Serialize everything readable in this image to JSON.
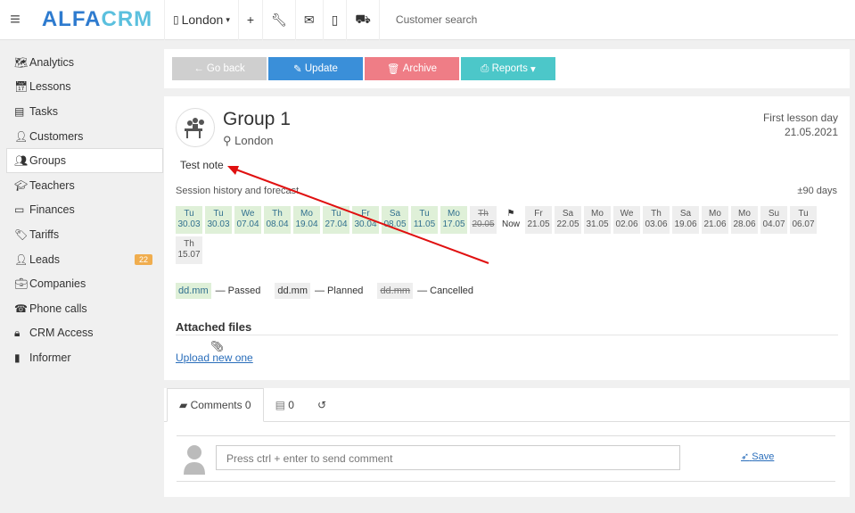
{
  "top": {
    "logo_a": "ALFA",
    "logo_b": "CRM",
    "branch": "London",
    "search": "Customer search"
  },
  "sidebar": {
    "items": [
      {
        "label": "Analytics",
        "icon": "map-icon"
      },
      {
        "label": "Lessons",
        "icon": "calendar-icon"
      },
      {
        "label": "Tasks",
        "icon": "tasks-icon"
      },
      {
        "label": "Customers",
        "icon": "user-icon"
      },
      {
        "label": "Groups",
        "icon": "group-icon"
      },
      {
        "label": "Teachers",
        "icon": "graduation-cap-icon"
      },
      {
        "label": "Finances",
        "icon": "money-icon"
      },
      {
        "label": "Tariffs",
        "icon": "tag-icon"
      },
      {
        "label": "Leads",
        "icon": "add-user-icon"
      },
      {
        "label": "Companies",
        "icon": "briefcase-icon"
      },
      {
        "label": "Phone calls",
        "icon": "phone-icon"
      },
      {
        "label": "CRM Access",
        "icon": "lock-icon"
      },
      {
        "label": "Informer",
        "icon": "book-icon"
      }
    ],
    "leads_badge": "22"
  },
  "actions": {
    "back": "← Go back",
    "update": "Update",
    "archive": "Archive",
    "reports": "Reports"
  },
  "group": {
    "title": "Group 1",
    "location": "London",
    "first_lesson_label": "First lesson day",
    "first_lesson_date": "21.05.2021",
    "note": "Test note",
    "history_label": "Session history and forecast",
    "range": "±90 days"
  },
  "days": [
    {
      "wd": "Tu",
      "dt": "30.03",
      "s": "p"
    },
    {
      "wd": "Tu",
      "dt": "30.03",
      "s": "p"
    },
    {
      "wd": "We",
      "dt": "07.04",
      "s": "p"
    },
    {
      "wd": "Th",
      "dt": "08.04",
      "s": "p"
    },
    {
      "wd": "Mo",
      "dt": "19.04",
      "s": "p"
    },
    {
      "wd": "Tu",
      "dt": "27.04",
      "s": "p"
    },
    {
      "wd": "Fr",
      "dt": "30.04",
      "s": "p"
    },
    {
      "wd": "Sa",
      "dt": "08.05",
      "s": "p"
    },
    {
      "wd": "Tu",
      "dt": "11.05",
      "s": "p"
    },
    {
      "wd": "Mo",
      "dt": "17.05",
      "s": "p"
    },
    {
      "wd": "Th",
      "dt": "20.05",
      "s": "c"
    },
    {
      "wd": "⚑",
      "dt": "Now",
      "s": "n"
    },
    {
      "wd": "Fr",
      "dt": "21.05",
      "s": "f"
    },
    {
      "wd": "Sa",
      "dt": "22.05",
      "s": "f"
    },
    {
      "wd": "Mo",
      "dt": "31.05",
      "s": "f"
    },
    {
      "wd": "We",
      "dt": "02.06",
      "s": "f"
    },
    {
      "wd": "Th",
      "dt": "03.06",
      "s": "f"
    },
    {
      "wd": "Sa",
      "dt": "19.06",
      "s": "f"
    },
    {
      "wd": "Mo",
      "dt": "21.06",
      "s": "f"
    },
    {
      "wd": "Mo",
      "dt": "28.06",
      "s": "f"
    },
    {
      "wd": "Su",
      "dt": "04.07",
      "s": "f"
    },
    {
      "wd": "Tu",
      "dt": "06.07",
      "s": "f"
    },
    {
      "wd": "Th",
      "dt": "15.07",
      "s": "f"
    }
  ],
  "legend": {
    "sample": "dd.mm",
    "passed": "— Passed",
    "planned": "— Planned",
    "cancelled": "— Cancelled"
  },
  "files": {
    "title": "Attached files",
    "upload": "Upload new one"
  },
  "comments": {
    "tab1": "Comments 0",
    "tab2": "0",
    "placeholder": "Press ctrl + enter to send comment",
    "save": "Save"
  },
  "colors": {
    "back": "#cfcfcf",
    "update": "#3a8fd9",
    "archive": "#ef7d86",
    "reports": "#4cc7c9"
  }
}
